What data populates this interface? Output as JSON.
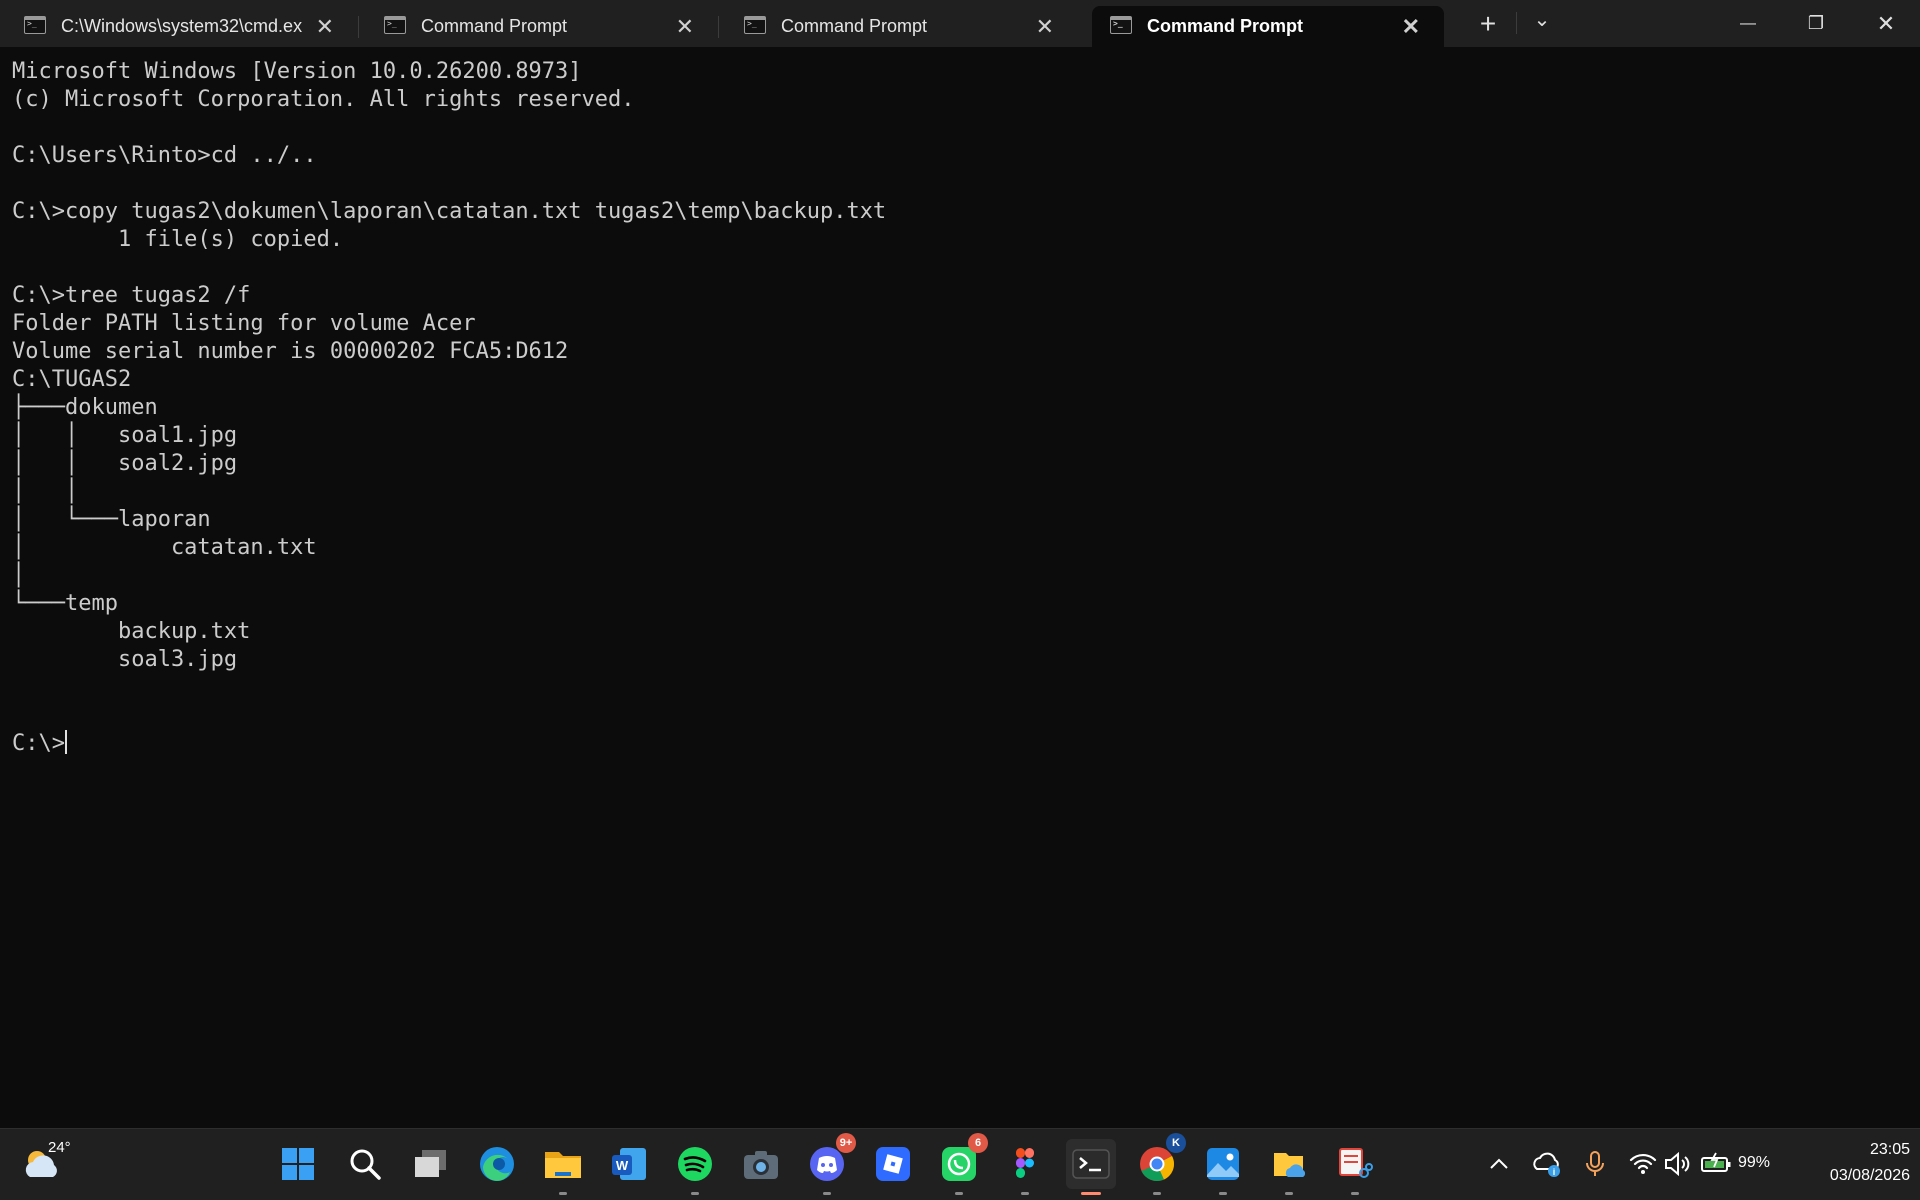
{
  "window": {
    "tabs": [
      {
        "title": "C:\\Windows\\system32\\cmd.ex",
        "close": "✕",
        "active": false
      },
      {
        "title": "Command Prompt",
        "close": "✕",
        "active": false
      },
      {
        "title": "Command Prompt",
        "close": "✕",
        "active": false
      },
      {
        "title": "Command Prompt",
        "close": "✕",
        "active": true
      }
    ],
    "new_tab": "+",
    "dropdown": "⌄",
    "minimize": "—",
    "maximize": "❐",
    "close": "✕"
  },
  "terminal": {
    "lines": [
      "Microsoft Windows [Version 10.0.26200.8973]",
      "(c) Microsoft Corporation. All rights reserved.",
      "",
      "C:\\Users\\Rinto>cd ../..",
      "",
      "C:\\>copy tugas2\\dokumen\\laporan\\catatan.txt tugas2\\temp\\backup.txt",
      "        1 file(s) copied.",
      "",
      "C:\\>tree tugas2 /f",
      "Folder PATH listing for volume Acer",
      "Volume serial number is 00000202 FCA5:D612",
      "C:\\TUGAS2",
      "├───dokumen",
      "│   │   soal1.jpg",
      "│   │   soal2.jpg",
      "│   │",
      "│   └───laporan",
      "│           catatan.txt",
      "│",
      "└───temp",
      "        backup.txt",
      "        soal3.jpg",
      "",
      ""
    ],
    "prompt": "C:\\>"
  },
  "taskbar": {
    "weather_temp": "24°",
    "apps": [
      {
        "name": "start",
        "badge": ""
      },
      {
        "name": "search",
        "badge": ""
      },
      {
        "name": "task-view",
        "badge": ""
      },
      {
        "name": "edge",
        "badge": ""
      },
      {
        "name": "file-explorer",
        "badge": ""
      },
      {
        "name": "word",
        "badge": ""
      },
      {
        "name": "spotify",
        "badge": ""
      },
      {
        "name": "camera",
        "badge": ""
      },
      {
        "name": "discord",
        "badge": "9+"
      },
      {
        "name": "roblox",
        "badge": ""
      },
      {
        "name": "whatsapp",
        "badge": "6"
      },
      {
        "name": "figma",
        "badge": ""
      },
      {
        "name": "terminal",
        "badge": ""
      },
      {
        "name": "chrome",
        "badge": "K"
      },
      {
        "name": "photos",
        "badge": ""
      },
      {
        "name": "file-manager",
        "badge": ""
      },
      {
        "name": "snipping-tool",
        "badge": ""
      }
    ],
    "battery": "99%",
    "time": "23:05",
    "date": "03/08/2026"
  }
}
